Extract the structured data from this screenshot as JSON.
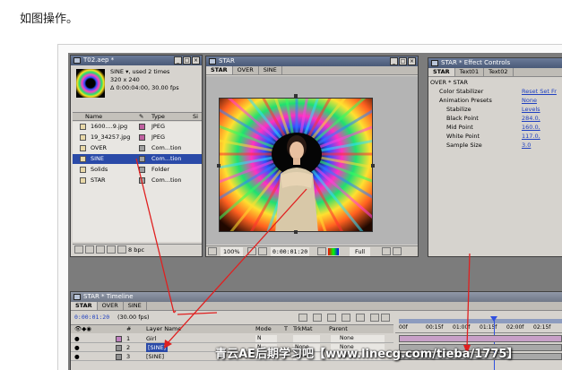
{
  "page": {
    "caption": "如图操作。"
  },
  "project": {
    "title": "T02.aep *",
    "info_name": "SINE ▾, used 2 times",
    "info_size": "320 x 240",
    "info_duration": "Δ 0:00:04:00, 30.00 fps",
    "col_name": "Name",
    "col_type": "Type",
    "col_size": "Si",
    "items": [
      {
        "name": "1600....9.jpg",
        "type": "JPEG",
        "color": "#c060a0",
        "icon": "image-file-icon"
      },
      {
        "name": "19_34257.jpg",
        "type": "JPEG",
        "color": "#c060a0",
        "icon": "image-file-icon"
      },
      {
        "name": "OVER",
        "type": "Com...tion",
        "color": "#a0a0a0",
        "icon": "composition-icon"
      },
      {
        "name": "SINE",
        "type": "Com...tion",
        "color": "#a0a0a0",
        "icon": "composition-icon",
        "selected": true
      },
      {
        "name": "Solids",
        "type": "Folder",
        "color": "#a0a0a0",
        "icon": "folder-icon"
      },
      {
        "name": "STAR",
        "type": "Com...tion",
        "color": "#a0a0a0",
        "icon": "composition-icon"
      }
    ],
    "bpc": "8 bpc"
  },
  "comp": {
    "title": "STAR",
    "tabs": [
      "STAR",
      "OVER",
      "SINE"
    ],
    "zoom": "100%",
    "timecode": "0:00:01:20",
    "resolution": "Full"
  },
  "effects": {
    "title": "STAR * Effect Controls",
    "tabs": [
      "STAR",
      "Text01",
      "Text02"
    ],
    "header": "OVER * STAR",
    "rows": [
      {
        "label": "Color Stabilizer",
        "value": "Reset Set Fr"
      },
      {
        "label": "Animation Presets",
        "value": "None"
      },
      {
        "label": "Stabilize",
        "value": "Levels"
      },
      {
        "label": "Black Point",
        "value": "284.0,"
      },
      {
        "label": "Mid Point",
        "value": "160.0,"
      },
      {
        "label": "White Point",
        "value": "117.0,"
      },
      {
        "label": "Sample Size",
        "value": "3.0"
      }
    ]
  },
  "timeline": {
    "title": "STAR * Timeline",
    "tabs": [
      "STAR",
      "OVER",
      "SINE"
    ],
    "timecode": "0:00:01:20",
    "fps": "(30.00 fps)",
    "col_num": "#",
    "col_layer": "Layer Name",
    "col_mode": "Mode",
    "col_t": "T",
    "col_trkmat": "TrkMat",
    "col_parent": "Parent",
    "ruler": [
      "00f",
      "00:15f",
      "01:00f",
      "01:15f",
      "02:00f",
      "02:15f"
    ],
    "layers": [
      {
        "num": "1",
        "name": "Girl",
        "mode": "N",
        "trkmat": "",
        "parent": "None",
        "color": "#c080c0"
      },
      {
        "num": "2",
        "name": "[SINE]",
        "mode": "N",
        "trkmat": "None",
        "parent": "None",
        "color": "#909090"
      },
      {
        "num": "3",
        "name": "[SINE]",
        "mode": "N",
        "trkmat": "None",
        "parent": "None",
        "color": "#909090"
      }
    ]
  },
  "watermark": "青云AE后期学习吧【www.linecg.com/tieba/1775】"
}
